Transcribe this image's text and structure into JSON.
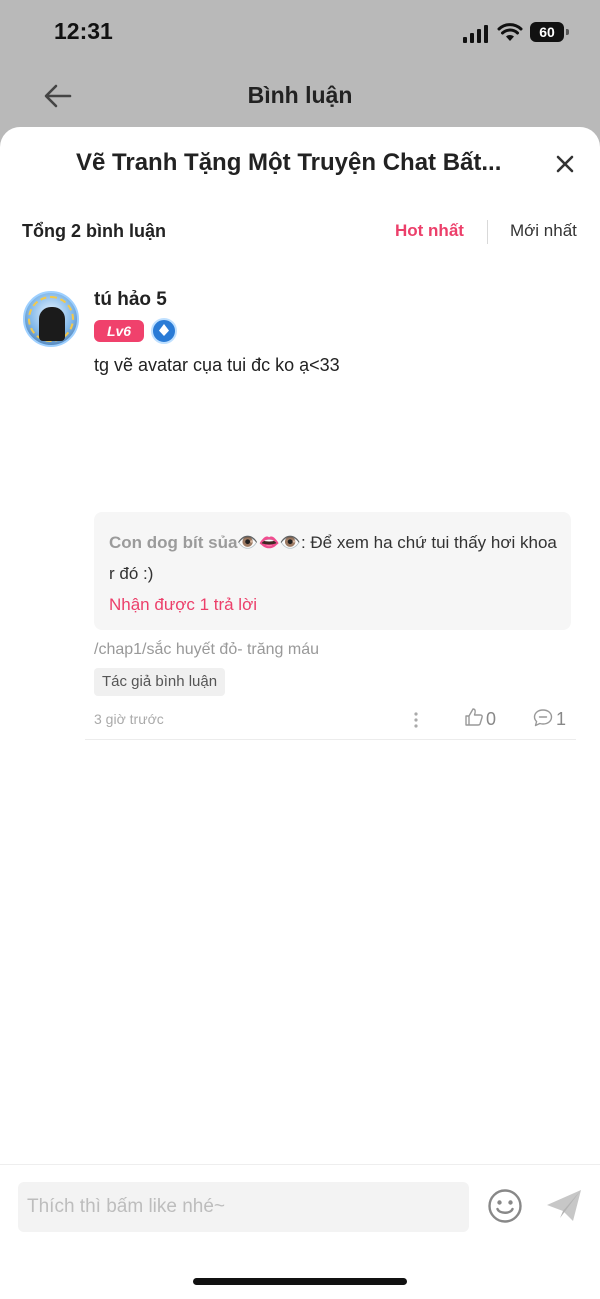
{
  "status_bar": {
    "time": "12:31",
    "battery": "60"
  },
  "nav": {
    "title": "Bình luận"
  },
  "sheet": {
    "title": "Vẽ Tranh Tặng Một Truyện Chat Bất...",
    "comment_count": "Tổng 2 bình luận",
    "sort_hot": "Hot nhất",
    "sort_new": "Mới nhất"
  },
  "comment": {
    "username": "tú hảo 5",
    "level": "Lv6",
    "text": "tg vẽ avatar cụa tui đc ko ạ<33",
    "reply_preview": {
      "author": "Con dog bít sủa👁️👄👁️",
      "text": ": Để xem ha chứ tui thấy hơi khoa r đó :)",
      "count_label": "Nhận được 1 trả lời"
    },
    "chapter": "/chap1/sắc huyết đỏ- trăng máu",
    "author_tag": "Tác giả bình luận",
    "time": "3 giờ trước",
    "likes": "0",
    "replies": "1"
  },
  "composer": {
    "placeholder": "Thích thì bấm like nhé~"
  },
  "colors": {
    "accent": "#ec3f6a",
    "level_badge": "#f0416c",
    "overlay": "#b9b9b9"
  },
  "icons": [
    "back-arrow-icon",
    "close-icon",
    "more-icon",
    "like-icon",
    "reply-icon",
    "emoji-icon",
    "send-icon",
    "signal-icon",
    "wifi-icon",
    "battery-icon"
  ]
}
